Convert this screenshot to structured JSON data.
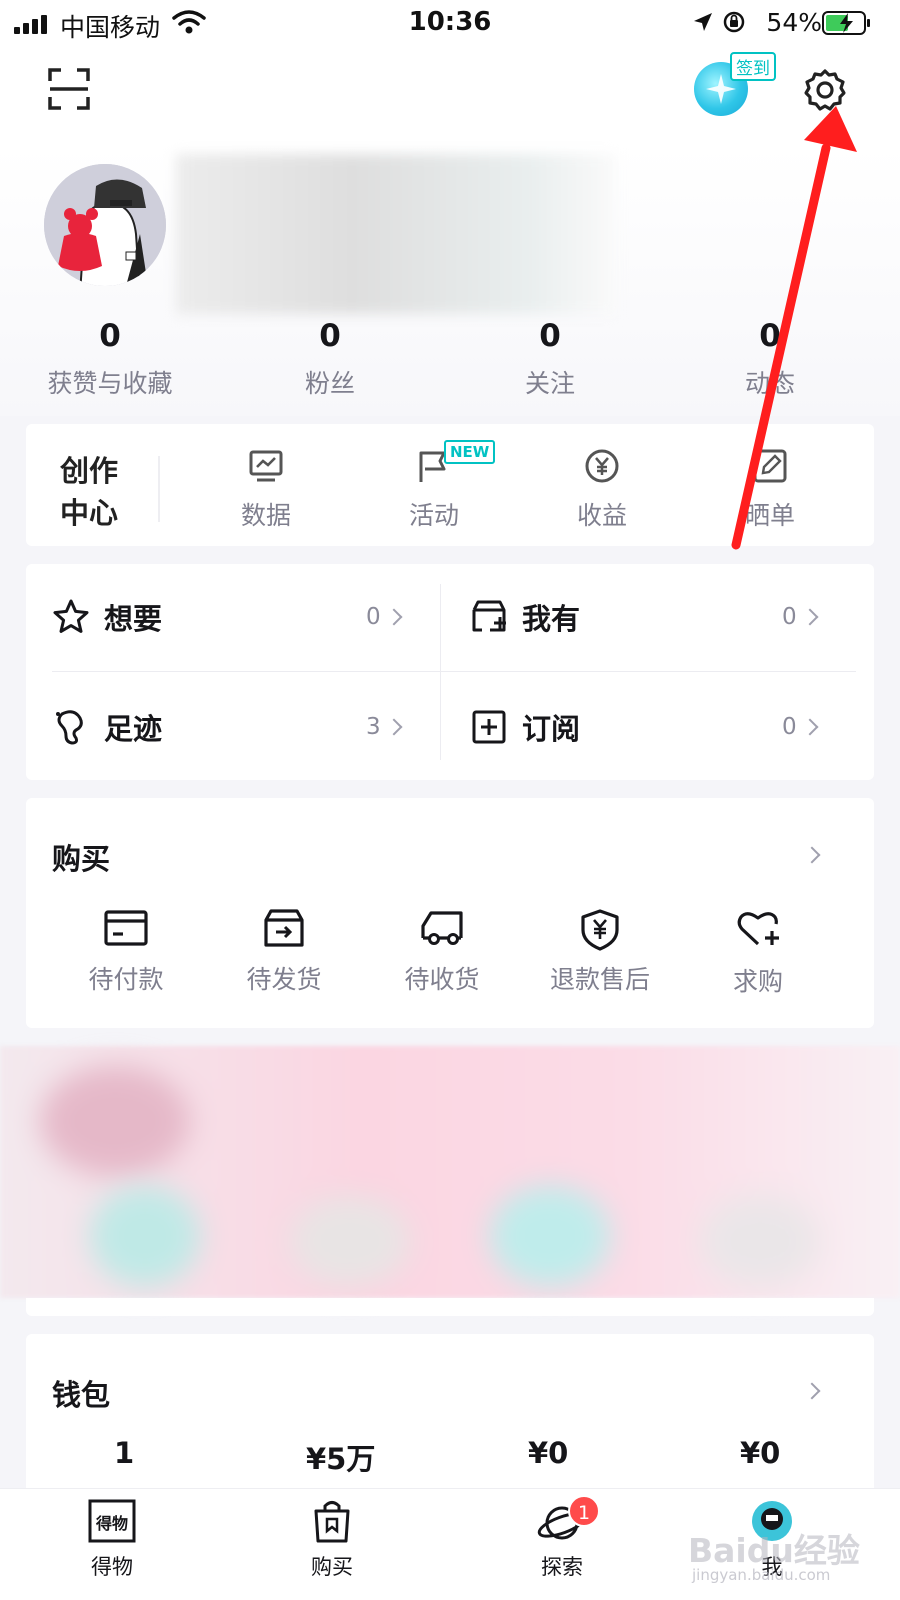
{
  "status_bar": {
    "carrier": "中国移动",
    "time": "10:36",
    "battery": "54%"
  },
  "header": {
    "checkin_label": "签到"
  },
  "profile": {
    "stats": [
      {
        "value": "0",
        "label": "获赞与收藏"
      },
      {
        "value": "0",
        "label": "粉丝"
      },
      {
        "value": "0",
        "label": "关注"
      },
      {
        "value": "0",
        "label": "动态"
      }
    ]
  },
  "creator_center": {
    "title_line1": "创作",
    "title_line2": "中心",
    "items": [
      {
        "label": "数据",
        "icon": "chart-icon"
      },
      {
        "label": "活动",
        "icon": "flag-icon",
        "badge": "NEW"
      },
      {
        "label": "收益",
        "icon": "yen-coin-icon"
      },
      {
        "label": "晒单",
        "icon": "edit-icon"
      }
    ]
  },
  "collections": [
    {
      "label": "想要",
      "count": "0",
      "icon": "star-icon"
    },
    {
      "label": "我有",
      "count": "0",
      "icon": "box-add-icon"
    },
    {
      "label": "足迹",
      "count": "3",
      "icon": "footprint-icon"
    },
    {
      "label": "订阅",
      "count": "0",
      "icon": "plus-square-icon"
    }
  ],
  "purchase": {
    "title": "购买",
    "items": [
      {
        "label": "待付款",
        "icon": "card-icon"
      },
      {
        "label": "待发货",
        "icon": "box-arrow-icon"
      },
      {
        "label": "待收货",
        "icon": "truck-icon"
      },
      {
        "label": "退款售后",
        "icon": "yen-shield-icon"
      },
      {
        "label": "求购",
        "icon": "heart-plus-icon"
      }
    ]
  },
  "wallet": {
    "title": "钱包",
    "values": [
      "1",
      "¥5万",
      "¥0",
      "¥0"
    ]
  },
  "tabbar": [
    {
      "label": "得物",
      "icon": "dewu-logo-icon"
    },
    {
      "label": "购买",
      "icon": "shopping-bag-icon"
    },
    {
      "label": "探索",
      "icon": "planet-icon",
      "badge": "1"
    },
    {
      "label": "我",
      "icon": "profile-avatar-icon"
    }
  ],
  "colors": {
    "accent_teal": "#01c2c3",
    "annotation_red": "#ff1e1e",
    "badge_red": "#ff4b4b"
  },
  "watermark": {
    "brand": "Baidu经验",
    "url": "jingyan.baidu.com"
  }
}
